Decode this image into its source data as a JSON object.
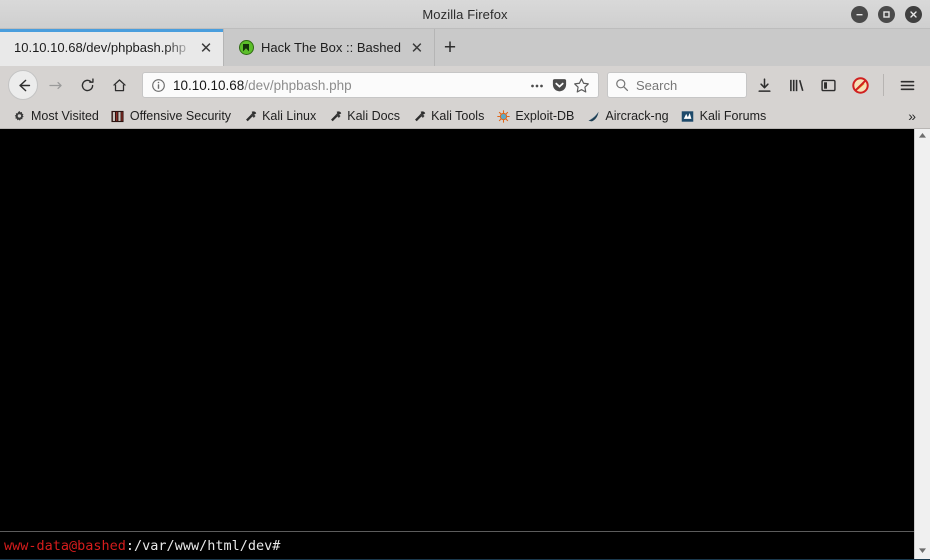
{
  "window": {
    "title": "Mozilla Firefox",
    "controls": {
      "minimize": "minimize",
      "maximize": "maximize",
      "close": "close"
    }
  },
  "tabs": [
    {
      "title": "10.10.10.68/dev/phpbash.php",
      "active": true,
      "favicon": "none",
      "close_label": "✕"
    },
    {
      "title": "Hack The Box :: Bashed",
      "active": false,
      "favicon": "htb-icon",
      "close_label": "✕"
    }
  ],
  "newtab_label": "+",
  "toolbar": {
    "back": "back-arrow",
    "forward": "forward-arrow",
    "reload": "reload",
    "home": "home",
    "url": {
      "host": "10.10.10.68",
      "path": "/dev/phpbash.php",
      "full": "10.10.10.68/dev/phpbash.php",
      "info_icon": "info-icon",
      "page_actions_icon": "ellipsis",
      "pocket_icon": "pocket",
      "bookmark_icon": "star"
    },
    "search_placeholder": "Search",
    "downloads": "download-icon",
    "library": "library-icon",
    "sidebar": "sidebar-icon",
    "noscript": "noscript-icon",
    "menu": "hamburger-menu"
  },
  "bookmarks": {
    "items": [
      {
        "label": "Most Visited",
        "icon": "gear-icon"
      },
      {
        "label": "Offensive Security",
        "icon": "offsec-icon"
      },
      {
        "label": "Kali Linux",
        "icon": "wrench-icon"
      },
      {
        "label": "Kali Docs",
        "icon": "wrench-icon"
      },
      {
        "label": "Kali Tools",
        "icon": "wrench-icon"
      },
      {
        "label": "Exploit-DB",
        "icon": "exploitdb-icon"
      },
      {
        "label": "Aircrack-ng",
        "icon": "aircrack-icon"
      },
      {
        "label": "Kali Forums",
        "icon": "forums-icon"
      }
    ],
    "overflow_label": "»"
  },
  "terminal": {
    "output": "",
    "prompt_user": "www-data@bashed",
    "prompt_path": ":/var/www/html/dev#",
    "colors": {
      "background": "#000000",
      "user": "#d51c1c",
      "path": "#e8e8e8"
    }
  },
  "scrollbar": {
    "up_arrow": "▲",
    "down_arrow": "▼"
  },
  "colors": {
    "accent": "#4a9edd",
    "chrome": "#d6d3d1",
    "window_border": "#1b3a4f"
  }
}
